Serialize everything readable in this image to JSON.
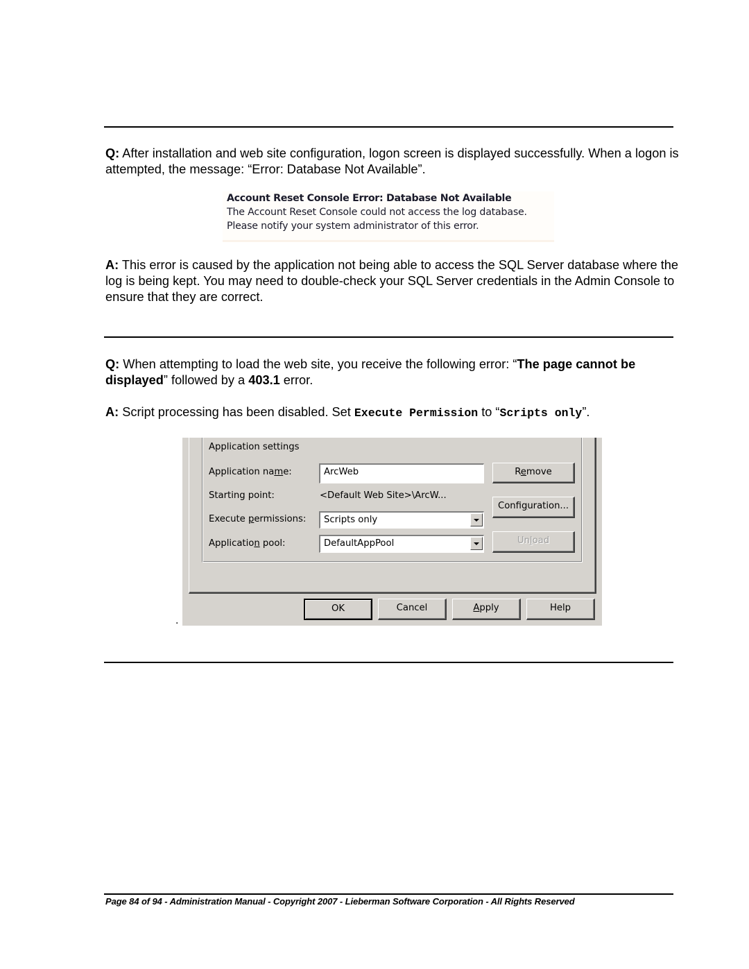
{
  "faq1": {
    "question_prefix": "Q:",
    "question_text": " After installation and web site configuration, logon screen is displayed successfully.  When a logon is attempted, the message: “Error: Database Not Available”.",
    "error_image": {
      "title": "Account Reset Console Error: Database Not Available",
      "line1": "The Account Reset Console could not access the log database.",
      "line2": "Please notify your system administrator of this error."
    },
    "answer_prefix": "A:",
    "answer_text": " This error is caused by the application not being able to access the SQL Server database where the log is being kept.  You may need to double-check your SQL Server credentials in the Admin Console to ensure that they are correct."
  },
  "faq2": {
    "question_prefix": "Q:",
    "question_text_1": " When attempting to load the web site, you receive the following error: “",
    "question_bold_1": "The page cannot be displayed",
    "question_text_2": "” followed by a ",
    "question_bold_2": "403.1",
    "question_text_3": " error.",
    "answer_prefix": "A:",
    "answer_text_1": " Script processing has been disabled.  Set ",
    "answer_code_1": "Execute Permission",
    "answer_text_2": " to “",
    "answer_code_2": "Scripts only",
    "answer_text_3": "”.",
    "dialog": {
      "group_title": "Application settings",
      "app_name_label_pre": "Application na",
      "app_name_label_u": "m",
      "app_name_label_post": "e:",
      "app_name_value": "ArcWeb",
      "starting_point_label": "Starting point:",
      "starting_point_value": "<Default Web Site>\\ArcW...",
      "exec_perm_label_pre": "Execute ",
      "exec_perm_label_u": "p",
      "exec_perm_label_post": "ermissions:",
      "exec_perm_value": "Scripts only",
      "app_pool_label_pre": "Applicatio",
      "app_pool_label_u": "n",
      "app_pool_label_post": " pool:",
      "app_pool_value": "DefaultAppPool",
      "remove_pre": "R",
      "remove_u": "e",
      "remove_post": "move",
      "config_pre": "Confi",
      "config_u": "g",
      "config_post": "uration...",
      "unload_pre": "Un",
      "unload_u": "l",
      "unload_post": "oad",
      "ok": "OK",
      "cancel": "Cancel",
      "apply_u": "A",
      "apply_post": "pply",
      "help": "Help"
    },
    "stray_dot": "."
  },
  "footer": "Page 84 of 94 - Administration Manual - Copyright 2007 - Lieberman Software Corporation - All Rights Reserved"
}
